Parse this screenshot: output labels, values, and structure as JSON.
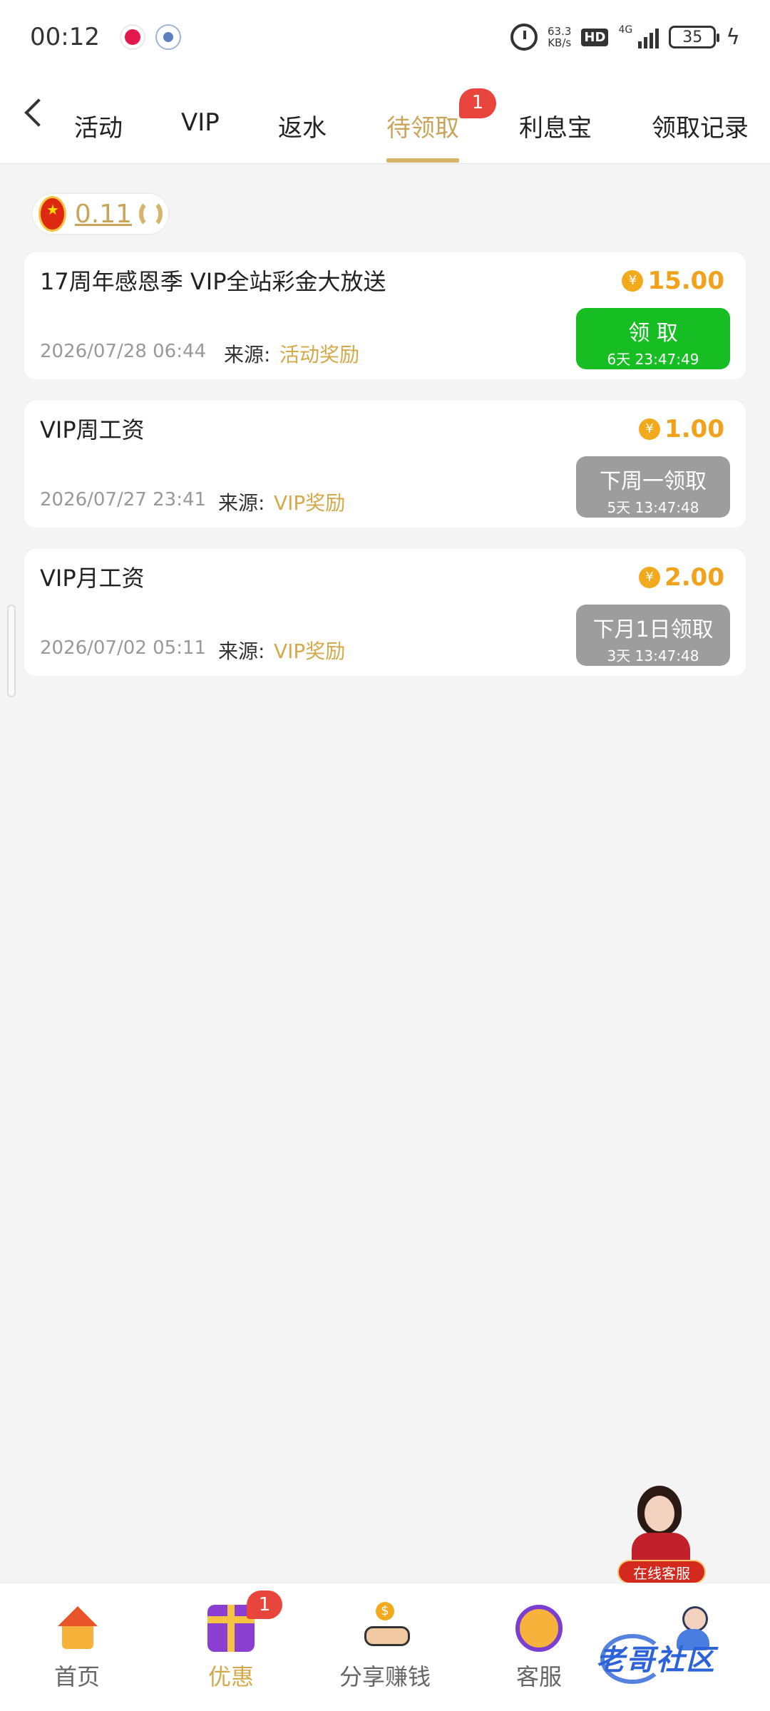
{
  "status_bar": {
    "time": "00:12",
    "net_speed_value": "63.3",
    "net_speed_unit": "KB/s",
    "hd": "HD",
    "net_type": "4G",
    "battery": "35"
  },
  "tabs": [
    {
      "label": "活动"
    },
    {
      "label": "VIP"
    },
    {
      "label": "返水"
    },
    {
      "label": "待领取",
      "badge": "1"
    },
    {
      "label": "利息宝"
    },
    {
      "label": "领取记录"
    }
  ],
  "wallet": {
    "balance": "0.11"
  },
  "rewards": [
    {
      "title": "17周年感恩季  VIP全站彩金大放送",
      "amount": "15.00",
      "date": "2026/07/28 06:44",
      "source_label": "来源:",
      "source": "活动奖励",
      "button_label": "领 取",
      "button_sub": "6天 23:47:49"
    },
    {
      "title": "VIP周工资",
      "amount": "1.00",
      "date": "2026/07/27 23:41",
      "source_label": "来源:",
      "source": "VIP奖励",
      "button_label": "下周一领取",
      "button_sub": "5天 13:47:48"
    },
    {
      "title": "VIP月工资",
      "amount": "2.00",
      "date": "2026/07/02 05:11",
      "source_label": "来源:",
      "source": "VIP奖励",
      "button_label": "下月1日领取",
      "button_sub": "3天 13:47:48"
    }
  ],
  "currency_symbol": "¥",
  "floating_service": {
    "label": "在线客服"
  },
  "bottom_nav": [
    {
      "label": "首页"
    },
    {
      "label": "优惠",
      "badge": "1"
    },
    {
      "label": "分享赚钱"
    },
    {
      "label": "客服"
    },
    {
      "label": ""
    }
  ],
  "watermark": "老哥社区",
  "colors": {
    "accent": "#d4a94a",
    "claim_green": "#16be24",
    "disabled_gray": "#9d9d9d",
    "badge_red": "#e8453c"
  }
}
